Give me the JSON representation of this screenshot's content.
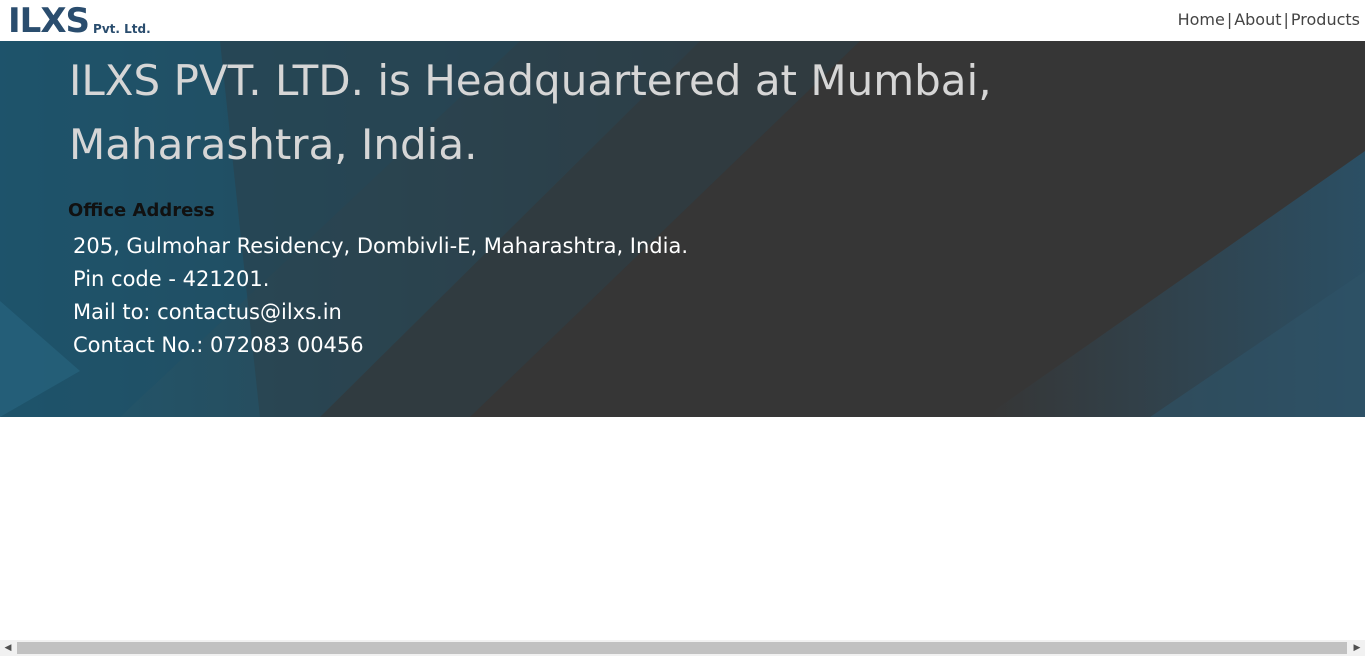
{
  "header": {
    "logo_text": "ILXS",
    "logo_subtext": "Pvt. Ltd.",
    "nav": [
      {
        "label": "Home"
      },
      {
        "label": "About"
      },
      {
        "label": "Products"
      }
    ],
    "separator": "|"
  },
  "hero": {
    "headline": "ILXS PVT. LTD. is Headquartered at Mumbai, Maharashtra, India.",
    "office_title": "Office Address",
    "address_lines": [
      "205, Gulmohar Residency, Dombivli-E, Maharashtra, India.",
      "Pin code - 421201.",
      "Mail to: contactus@ilxs.in",
      "Contact No.: 072083 00456"
    ]
  },
  "colors": {
    "brand_blue": "#2a4d6e",
    "brand_red": "#d23b3b",
    "hero_dark": "#373737",
    "hero_teal": "#2a5a70",
    "headline_text": "#d6d6d6",
    "address_text": "#ffffff"
  },
  "scrollbar": {
    "left_arrow": "◀",
    "right_arrow": "▶"
  }
}
